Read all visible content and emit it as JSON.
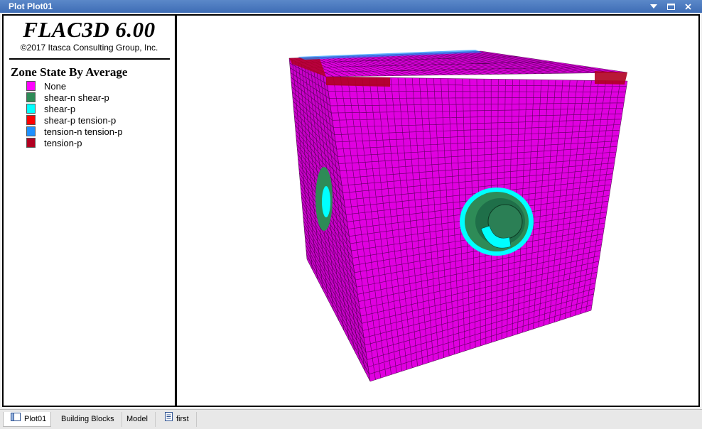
{
  "window": {
    "title": "Plot Plot01"
  },
  "legend": {
    "product": "FLAC3D 6.00",
    "copyright": "©2017 Itasca Consulting Group, Inc.",
    "title": "Zone State By Average",
    "items": [
      {
        "label": "None",
        "color": "#ff00ff"
      },
      {
        "label": "shear-n shear-p",
        "color": "#2e8b57"
      },
      {
        "label": "shear-p",
        "color": "#00ffff"
      },
      {
        "label": "shear-p tension-p",
        "color": "#ff0000"
      },
      {
        "label": "tension-n tension-p",
        "color": "#1e90ff"
      },
      {
        "label": "tension-p",
        "color": "#b00020"
      }
    ]
  },
  "tabs": [
    {
      "label": "Plot01",
      "icon": "plot-window-icon",
      "active": true
    },
    {
      "label": "Building Blocks",
      "active": false
    },
    {
      "label": "Model",
      "active": false
    },
    {
      "label": "first",
      "icon": "document-icon",
      "active": false
    }
  ],
  "colors": {
    "titlebar": "#4a78bf",
    "mesh_line": "#3a003a",
    "face_main": "#e000e0",
    "face_side": "#c800c8"
  }
}
